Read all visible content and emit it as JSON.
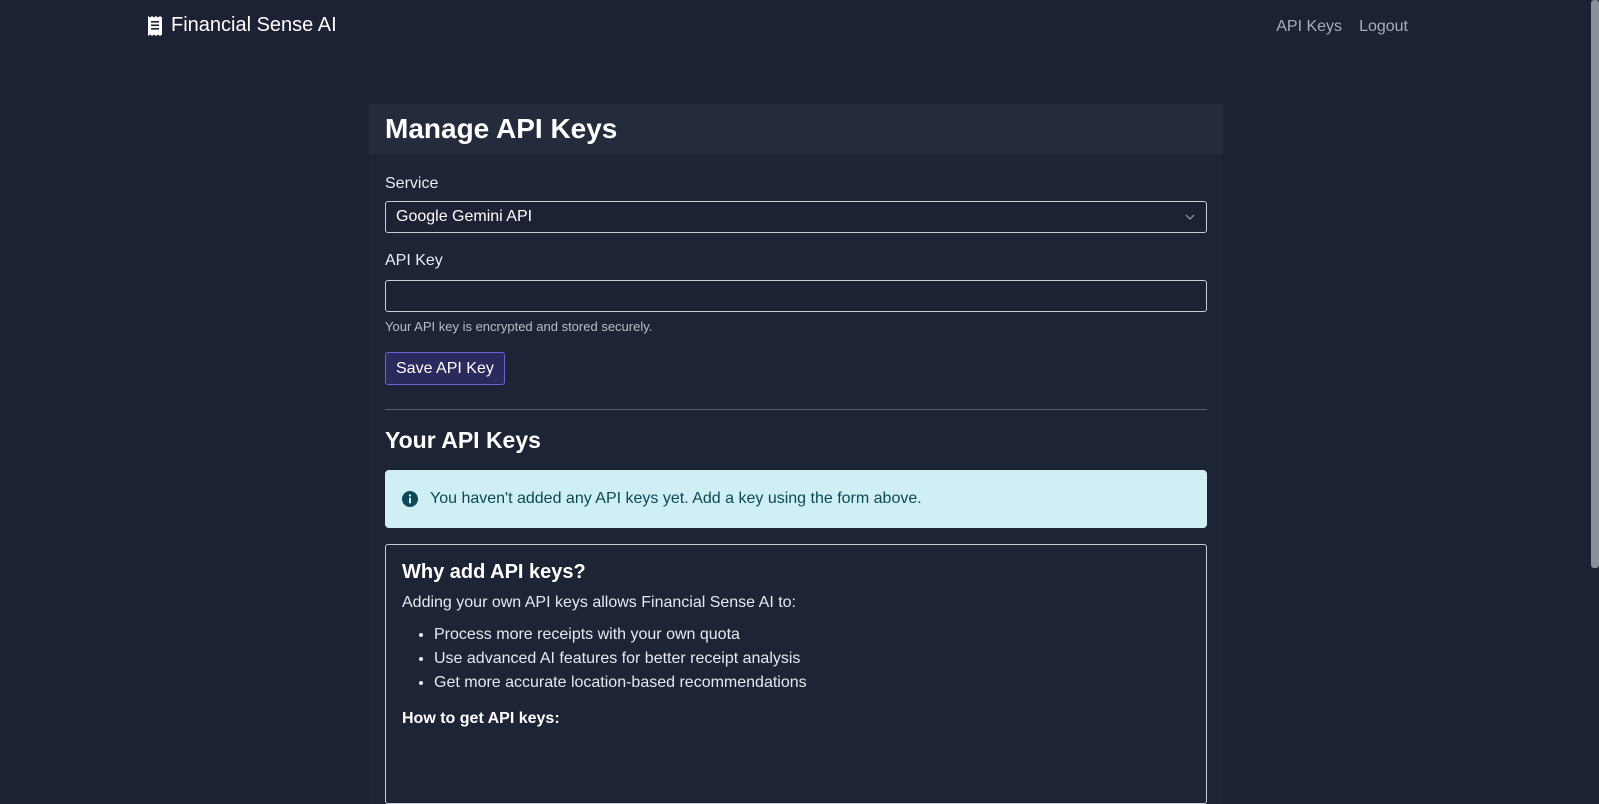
{
  "navbar": {
    "brand": "Financial Sense AI",
    "brand_icon": "receipt-icon",
    "links": [
      "API Keys",
      "Logout"
    ]
  },
  "page": {
    "title": "Manage API Keys"
  },
  "form": {
    "service_label": "Service",
    "service_value": "Google Gemini API",
    "api_key_label": "API Key",
    "api_key_value": "",
    "help_text": "Your API key is encrypted and stored securely.",
    "save_label": "Save API Key"
  },
  "keys_section": {
    "title": "Your API Keys",
    "empty_message": "You haven't added any API keys yet. Add a key using the form above."
  },
  "info": {
    "title": "Why add API keys?",
    "intro": "Adding your own API keys allows Financial Sense AI to:",
    "benefits": [
      "Process more receipts with your own quota",
      "Use advanced AI features for better receipt analysis",
      "Get more accurate location-based recommendations"
    ],
    "howto_title": "How to get API keys:"
  },
  "colors": {
    "background": "#1c2233",
    "alert_bg": "#cfeff5",
    "alert_text": "#0b4957",
    "button_border": "#6d5fd6"
  }
}
